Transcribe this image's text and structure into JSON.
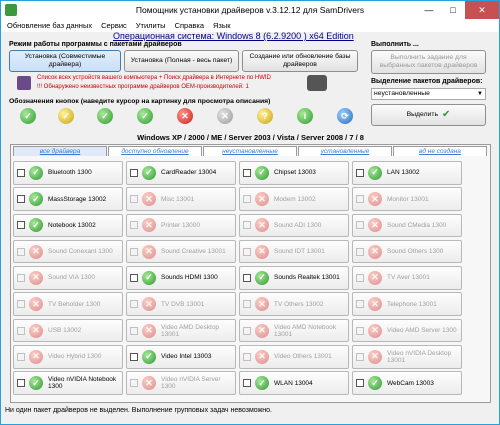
{
  "title": "Помощник установки драйверов v.3.12.12 для SamDrivers",
  "window_buttons": {
    "minimize": "—",
    "maximize": "□",
    "close": "✕"
  },
  "menu": [
    "Обновление баз данных",
    "Сервис",
    "Утилиты",
    "Справка",
    "Язык"
  ],
  "os_label": "Операционная система: Windows 8  (6.2.9200 ) x64 Edition",
  "mode_group_title": "Режим работы программы с пакетами драйверов",
  "mode_buttons": [
    "Установка (Совместимые драйвера)",
    "Установка (Полная - весь пакет)",
    "Создание или обновление базы драйверов"
  ],
  "warnings": [
    "Список всех устройств вашего компьютера + Поиск драйвера в Интернете по HWID",
    "!!! Обнаружено неизвестных программе драйверов OEM-производителей: 1"
  ],
  "legend_title": "Обозначения кнопок (наведите курсор на картинку для просмотра описания)",
  "run_title": "Выполнить ...",
  "run_button": "Выполнить задание для выбранных пакетов драйверов",
  "selection_title": "Выделение пакетов драйверов:",
  "selection_value": "неустановленные",
  "select_button": "Выделить",
  "os_header": "Windows XP / 2000 / ME / Server 2003 / Vista / Server 2008 / 7 / 8",
  "tabs": [
    "все драйвера",
    "доступно обновление",
    "неустановленные",
    "установленные",
    "вд не создана"
  ],
  "cards": [
    {
      "label": "Bluetooth 1300",
      "state": "green"
    },
    {
      "label": "CardReader 13004",
      "state": "green"
    },
    {
      "label": "Chipset 13003",
      "state": "green"
    },
    {
      "label": "LAN 13002",
      "state": "green"
    },
    {
      "label": "MassStorage 13002",
      "state": "green"
    },
    {
      "label": "Misc 13001",
      "state": "gray"
    },
    {
      "label": "Modem 13002",
      "state": "gray"
    },
    {
      "label": "Monitor 13001",
      "state": "gray"
    },
    {
      "label": "Notebook 13002",
      "state": "green"
    },
    {
      "label": "Printer 13000",
      "state": "gray"
    },
    {
      "label": "Sound ADI 1300",
      "state": "gray"
    },
    {
      "label": "Sound CMedia 1300",
      "state": "gray"
    },
    {
      "label": "Sound Conexant 1300",
      "state": "gray"
    },
    {
      "label": "Sound Creative 13001",
      "state": "gray"
    },
    {
      "label": "Sound IDT 13001",
      "state": "gray"
    },
    {
      "label": "Sound Others 1300",
      "state": "gray"
    },
    {
      "label": "Sound VIA 1300",
      "state": "gray"
    },
    {
      "label": "Sounds HDMI 1300",
      "state": "green"
    },
    {
      "label": "Sounds Realtek 13001",
      "state": "green"
    },
    {
      "label": "TV Aver 13001",
      "state": "gray"
    },
    {
      "label": "TV Beholder 1300",
      "state": "gray"
    },
    {
      "label": "TV DVB 13001",
      "state": "gray"
    },
    {
      "label": "TV Others 13002",
      "state": "gray"
    },
    {
      "label": "Telephone 13001",
      "state": "gray"
    },
    {
      "label": "USB 13002",
      "state": "gray"
    },
    {
      "label": "Video AMD Desktop 13001",
      "state": "gray"
    },
    {
      "label": "Video AMD Notebook 13001",
      "state": "gray"
    },
    {
      "label": "Video AMD Server 1300",
      "state": "gray"
    },
    {
      "label": "Video Hybrid 1300",
      "state": "gray"
    },
    {
      "label": "Video Intel 13003",
      "state": "green"
    },
    {
      "label": "Video Others 13001",
      "state": "gray"
    },
    {
      "label": "Video nVIDIA Desktop 13001",
      "state": "gray"
    },
    {
      "label": "Video nVIDIA Notebook 1300",
      "state": "green"
    },
    {
      "label": "Video nVIDIA Server 1300",
      "state": "gray"
    },
    {
      "label": "WLAN 13004",
      "state": "green"
    },
    {
      "label": "WebCam 13003",
      "state": "green"
    }
  ],
  "status": "Ни один пакет драйверов не выделен. Выполнение групповых задач невозможно."
}
